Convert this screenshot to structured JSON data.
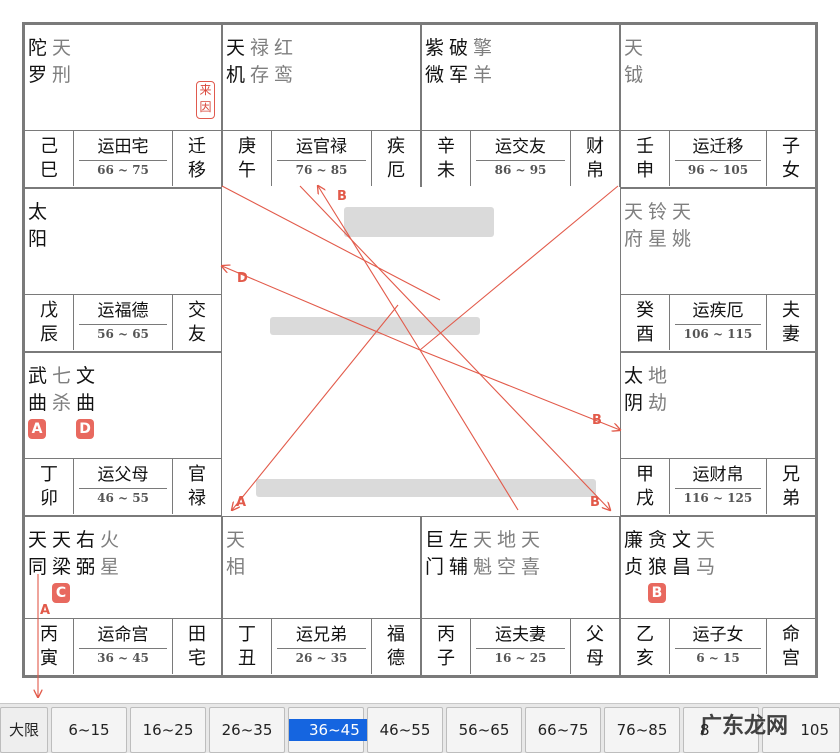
{
  "palaces": [
    {
      "major": [
        "陀",
        "罗"
      ],
      "minor2": [
        "天",
        "刑"
      ],
      "gz": [
        "己",
        "巳"
      ],
      "yun": "运田宅",
      "range": "66 ~ 75",
      "gong": [
        "迁",
        "移"
      ]
    },
    {
      "major": [
        "天",
        "机"
      ],
      "minor2": [
        "禄",
        "存"
      ],
      "minor3": [
        "红",
        "鸾"
      ],
      "gz": [
        "庚",
        "午"
      ],
      "yun": "运官禄",
      "range": "76 ~ 85",
      "gong": [
        "疾",
        "厄"
      ]
    },
    {
      "major": [
        "紫",
        "微"
      ],
      "major2": [
        "破",
        "军"
      ],
      "minor3": [
        "擎",
        "羊"
      ],
      "gz": [
        "辛",
        "未"
      ],
      "yun": "运交友",
      "range": "86 ~ 95",
      "gong": [
        "财",
        "帛"
      ]
    },
    {
      "minor1": [
        "天",
        "钺"
      ],
      "gz": [
        "壬",
        "申"
      ],
      "yun": "运迁移",
      "range": "96 ~ 105",
      "gong": [
        "子",
        "女"
      ]
    },
    {
      "major": [
        "太",
        "阳"
      ],
      "gz": [
        "戊",
        "辰"
      ],
      "yun": "运福德",
      "range": "56 ~ 65",
      "gong": [
        "交",
        "友"
      ]
    },
    {
      "minor1": [
        "天",
        "府"
      ],
      "minor2": [
        "铃",
        "星"
      ],
      "minor3": [
        "天",
        "姚"
      ],
      "gz": [
        "癸",
        "酉"
      ],
      "yun": "运疾厄",
      "range": "106 ~ 115",
      "gong": [
        "夫",
        "妻"
      ]
    },
    {
      "major": [
        "武",
        "曲"
      ],
      "minor2": [
        "七",
        "杀"
      ],
      "major3": [
        "文",
        "曲"
      ],
      "gz": [
        "丁",
        "卯"
      ],
      "yun": "运父母",
      "range": "46 ~ 55",
      "gong": [
        "官",
        "禄"
      ]
    },
    {
      "major": [
        "太",
        "阴"
      ],
      "minor2": [
        "地",
        "劫"
      ],
      "gz": [
        "甲",
        "戌"
      ],
      "yun": "运财帛",
      "range": "116 ~ 125",
      "gong": [
        "兄",
        "弟"
      ]
    },
    {
      "major": [
        "天",
        "同"
      ],
      "major2": [
        "天",
        "梁"
      ],
      "major3": [
        "右",
        "弼"
      ],
      "minor4": [
        "火",
        "星"
      ],
      "gz": [
        "丙",
        "寅"
      ],
      "yun": "运命宫",
      "range": "36 ~ 45",
      "gong": [
        "田",
        "宅"
      ]
    },
    {
      "minor1": [
        "天",
        "相"
      ],
      "gz": [
        "丁",
        "丑"
      ],
      "yun": "运兄弟",
      "range": "26 ~ 35",
      "gong": [
        "福",
        "德"
      ]
    },
    {
      "major": [
        "巨",
        "门"
      ],
      "major2": [
        "左",
        "辅"
      ],
      "minor3": [
        "天",
        "魁"
      ],
      "minor4": [
        "地",
        "空"
      ],
      "minor5": [
        "天",
        "喜"
      ],
      "gz": [
        "丙",
        "子"
      ],
      "yun": "运夫妻",
      "range": "16 ~ 25",
      "gong": [
        "父",
        "母"
      ]
    },
    {
      "major": [
        "廉",
        "贞"
      ],
      "major2": [
        "贪",
        "狼"
      ],
      "major3": [
        "文",
        "昌"
      ],
      "minor4": [
        "天",
        "马"
      ],
      "gz": [
        "乙",
        "亥"
      ],
      "yun": "运子女",
      "range": "6 ~ 15",
      "gong": [
        "命",
        "宫"
      ]
    }
  ],
  "badges": {
    "a": "A",
    "b": "B",
    "c": "C",
    "d": "D"
  },
  "stamp": "来因",
  "arrow_labels": {
    "a": "A",
    "b": "B",
    "d": "D"
  },
  "bar": {
    "label": "大限",
    "items": [
      "6~15",
      "16~25",
      "26~35",
      "36~45",
      "46~55",
      "56~65",
      "66~75",
      "76~85",
      "8",
      "105"
    ],
    "active": "36~45"
  },
  "watermark": "广东龙网",
  "colors": {
    "accent": "#1565e0",
    "badge": "#e8695f",
    "line": "#e25a4a"
  }
}
